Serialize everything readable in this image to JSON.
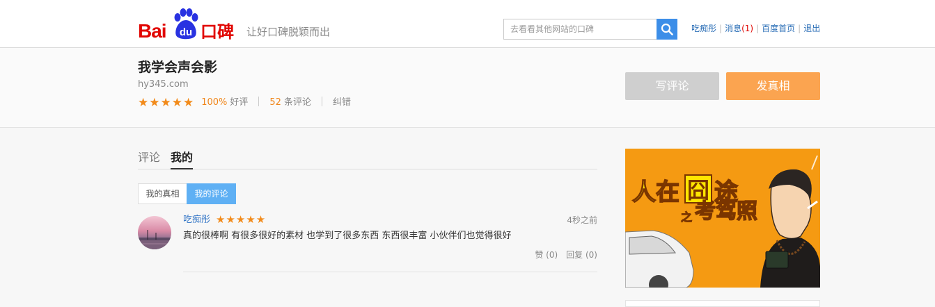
{
  "header": {
    "logo_bai": "Bai",
    "logo_du": "du",
    "logo_koubei": "口碑",
    "slogan": "让好口碑脱颖而出",
    "search_placeholder": "去看看其他网站的口碑",
    "user_links": {
      "username": "吃痴彤",
      "messages_label": "消息",
      "messages_count": "(1)",
      "home": "百度首页",
      "logout": "退出"
    }
  },
  "site": {
    "title": "我学会声会影",
    "domain": "hy345.com",
    "stars": "★★★★★",
    "good_percent": "100%",
    "good_label": "好评",
    "review_count": "52",
    "review_label": "条评论",
    "correction": "纠错",
    "write_review_button": "写评论",
    "post_truth_button": "发真相"
  },
  "tabs": {
    "reviews": "评论",
    "mine": "我的"
  },
  "subtabs": {
    "my_truths": "我的真相",
    "my_reviews": "我的评论"
  },
  "comment": {
    "user": "吃痴彤",
    "stars": "★★★★★",
    "rating": 5,
    "time": "4秒之前",
    "text": "真的很棒啊 有很多很好的素材 也学到了很多东西  东西很丰富 小伙伴们也觉得很好",
    "like": "赞 (0)",
    "reply": "回复 (0)"
  },
  "ad": {
    "headline_1": "人在",
    "headline_box": "囧",
    "headline_2": "途",
    "sub_1": "之",
    "sub_2": "考驾照"
  },
  "colors": {
    "brand_red": "#e10602",
    "link_blue": "#2c6fb7",
    "accent_orange": "#f08519",
    "active_subtab": "#5fb0f4",
    "truth_button": "#fba450",
    "search_button": "#3c8ee8"
  }
}
